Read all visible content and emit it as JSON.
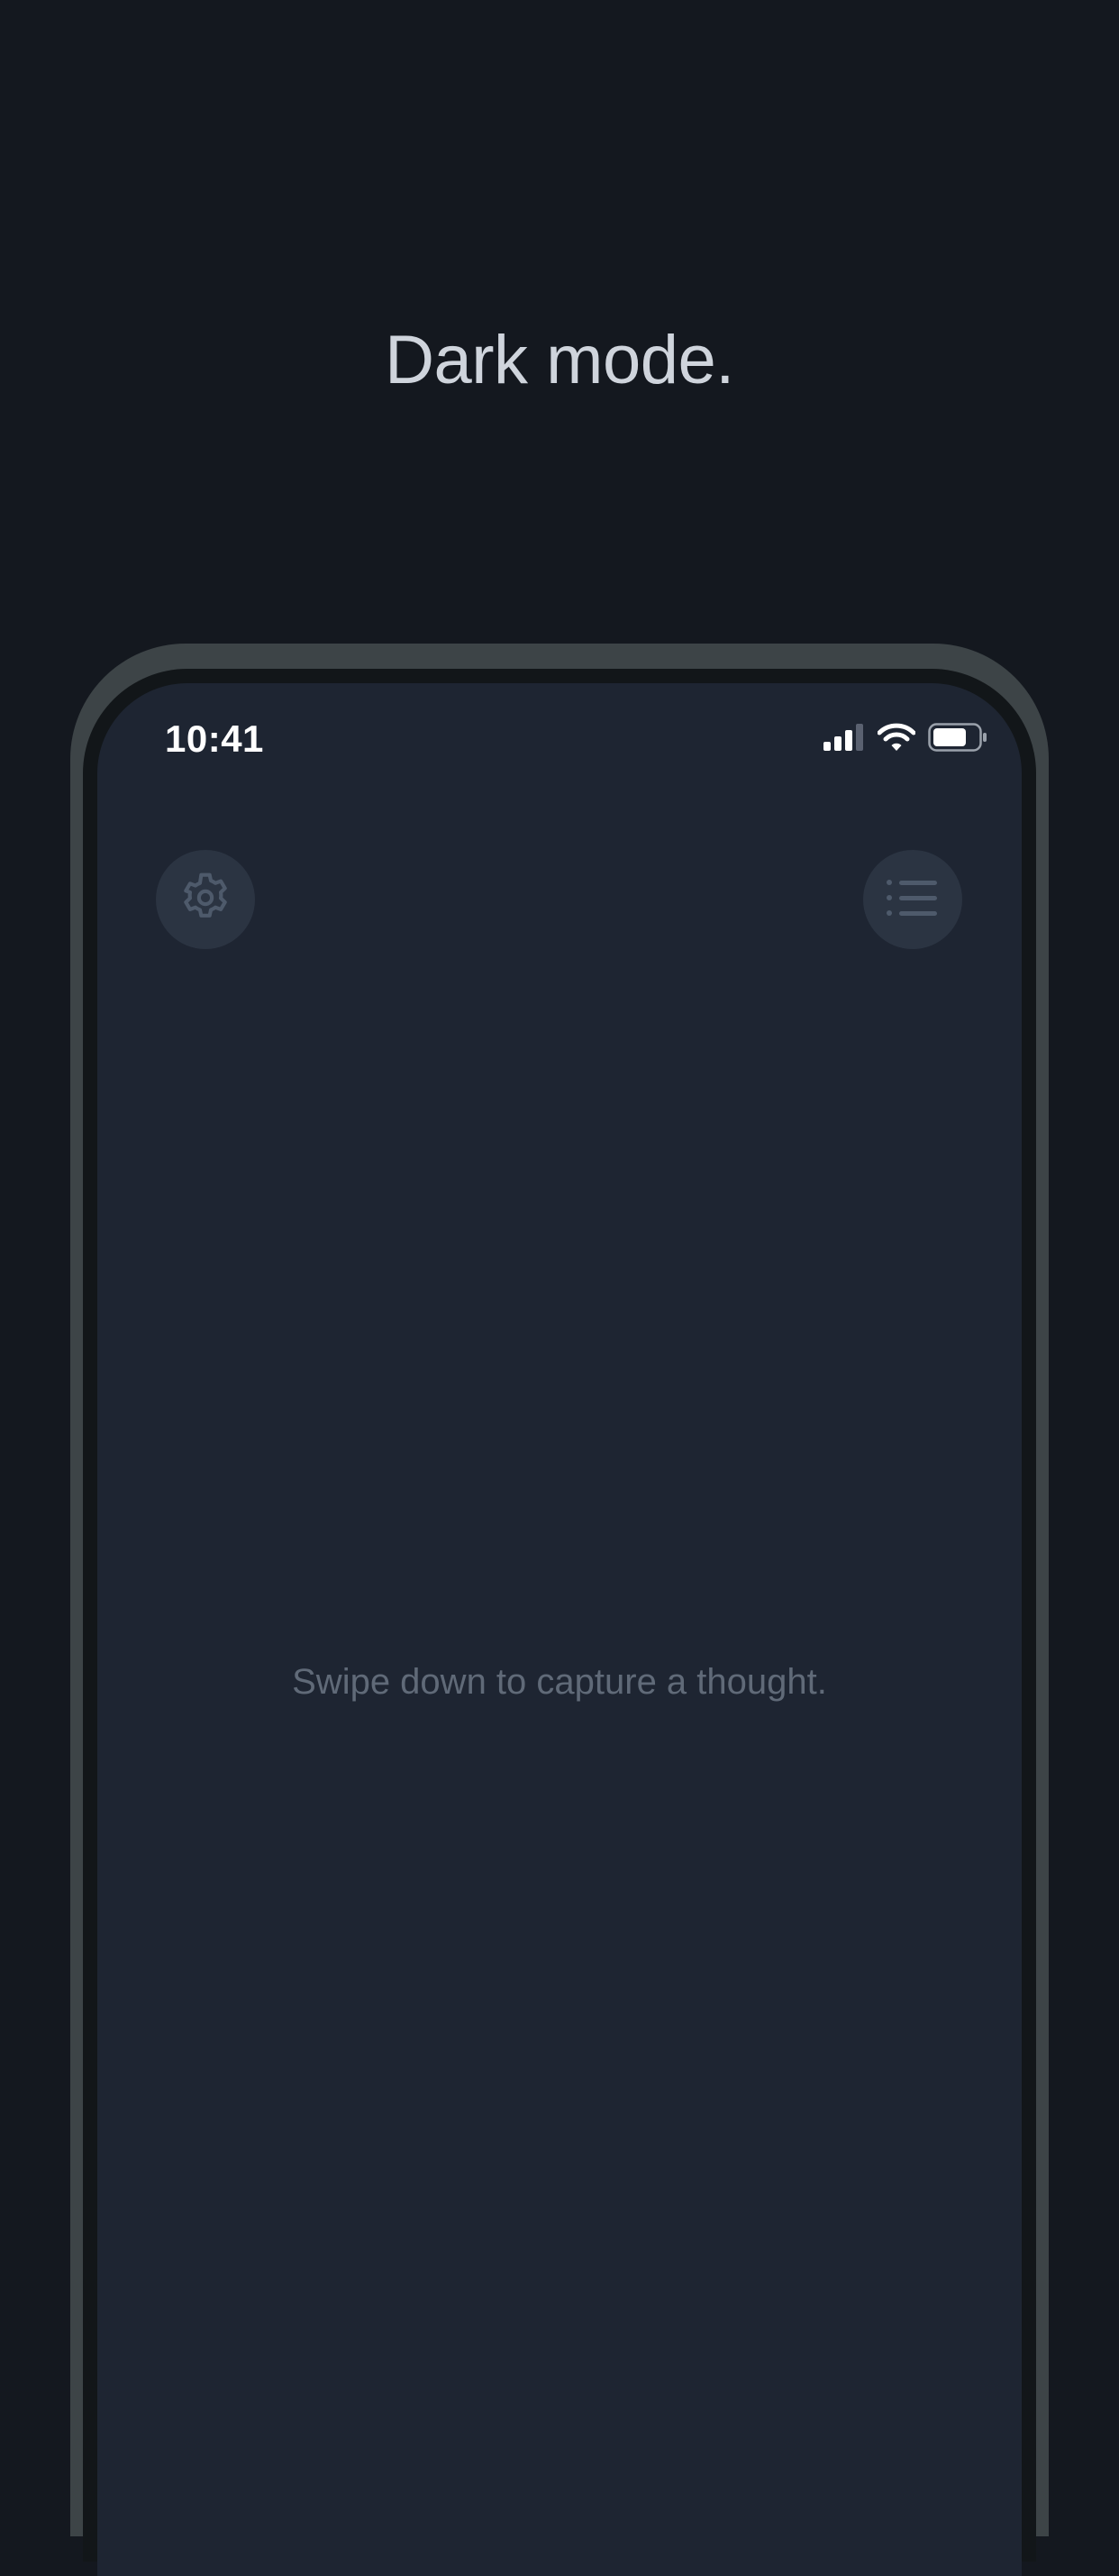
{
  "headline": "Dark mode.",
  "status_bar": {
    "time": "10:41",
    "icons": [
      "signal-icon",
      "wifi-icon",
      "battery-icon"
    ]
  },
  "toolbar": {
    "left_button_icon": "gear-icon",
    "right_button_icon": "list-icon"
  },
  "main": {
    "empty_hint": "Swipe down to capture a thought."
  },
  "colors": {
    "page_background": "#14181f",
    "screen_background": "#1e2532",
    "button_background": "#2b3442",
    "icon_color": "#4e5a6b",
    "hint_text": "#606a78",
    "headline_text": "#cfd4dc"
  }
}
